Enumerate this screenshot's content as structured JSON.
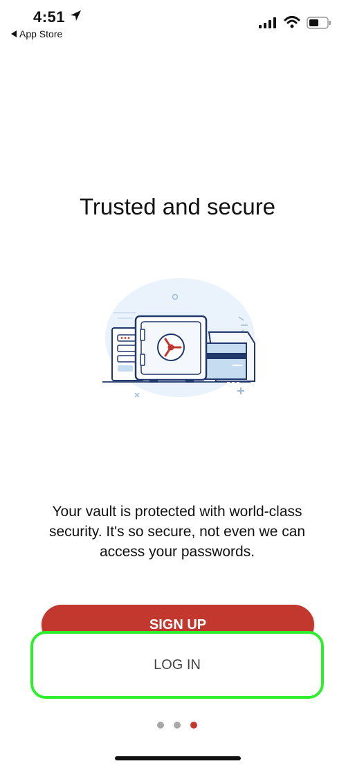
{
  "status_bar": {
    "time": "4:51",
    "back_app": "App Store",
    "signal_icon": "cellular-signal-icon",
    "wifi_icon": "wifi-icon",
    "battery_icon": "battery-icon"
  },
  "onboarding": {
    "title": "Trusted and secure",
    "illustration_icon": "vault-safe-illustration",
    "description": "Your vault is protected with world-class security. It's so secure, not even we can access your passwords.",
    "signup_label": "SIGN UP",
    "login_label": "LOG IN",
    "page_count": 3,
    "current_page": 3
  },
  "colors": {
    "accent": "#c2382f",
    "highlight": "#2cf02c",
    "dot_inactive": "#a7a7a7"
  }
}
